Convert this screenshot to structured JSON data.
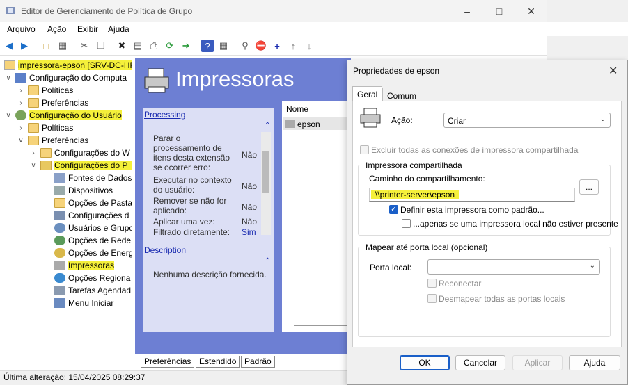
{
  "window": {
    "title": "Editor de Gerenciamento de Política de Grupo"
  },
  "menu": [
    "Arquivo",
    "Ação",
    "Exibir",
    "Ajuda"
  ],
  "tree": [
    {
      "label": "impressora-epson [SRV-DC-HR"
    },
    {
      "label": "Configuração do Computa"
    },
    {
      "label": "Políticas"
    },
    {
      "label": "Preferências"
    },
    {
      "label": "Configuração do Usuário"
    },
    {
      "label": "Políticas"
    },
    {
      "label": "Preferências"
    },
    {
      "label": "Configurações do W"
    },
    {
      "label": "Configurações do P"
    },
    {
      "label": "Fontes de Dados"
    },
    {
      "label": "Dispositivos"
    },
    {
      "label": "Opções de Pasta"
    },
    {
      "label": "Configurações d"
    },
    {
      "label": "Usuários e Grupo"
    },
    {
      "label": "Opções de Rede"
    },
    {
      "label": "Opções de Energ"
    },
    {
      "label": "Impressoras"
    },
    {
      "label": "Opções Regiona"
    },
    {
      "label": "Tarefas Agendad"
    },
    {
      "label": "Menu Iniciar"
    }
  ],
  "center": {
    "heading": "Impressoras",
    "processing_link": "Processing",
    "processing_rows": [
      {
        "label": "Parar o processamento de itens desta extensão se ocorrer erro:",
        "value": "Não"
      },
      {
        "label": "Executar no contexto do usuário:",
        "value": "Não"
      },
      {
        "label": "Remover se não for aplicado:",
        "value": "Não"
      },
      {
        "label": "Aplicar uma vez:",
        "value": "Não"
      },
      {
        "label": "Filtrado diretamente:",
        "value": "Sim"
      }
    ],
    "description_link": "Description",
    "description_text": "Nenhuma descrição fornecida.",
    "list_header": "Nome",
    "list_item": "epson",
    "bottom_tabs": [
      "Preferências",
      "Estendido",
      "Padrão"
    ]
  },
  "status": "Última alteração: 15/04/2025 08:29:37",
  "dialog": {
    "title": "Propriedades de epson",
    "tabs": [
      "Geral",
      "Comum"
    ],
    "action_label": "Ação:",
    "action_value": "Criar",
    "exclude_label": "Excluir todas as conexões de impressora compartilhada",
    "shared_group": "Impressora compartilhada",
    "share_path_label": "Caminho do compartilhamento:",
    "share_path_value": "\\\\printer-server\\epson",
    "browse": "...",
    "default_label": "Definir esta impressora como padrão...",
    "only_if_label": "...apenas se uma impressora local não estiver presente",
    "map_group": "Mapear até porta local (opcional)",
    "local_port_label": "Porta local:",
    "local_port_value": "",
    "reconnect_label": "Reconectar",
    "unmap_label": "Desmapear todas as portas locais",
    "buttons": {
      "ok": "OK",
      "cancel": "Cancelar",
      "apply": "Aplicar",
      "help": "Ajuda"
    }
  }
}
